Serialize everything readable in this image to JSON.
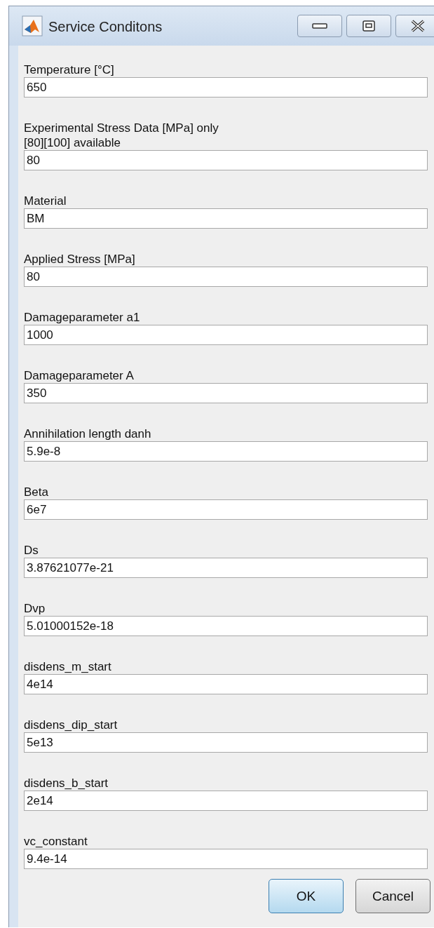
{
  "window": {
    "title": "Service Conditons"
  },
  "fields": [
    {
      "label": "Temperature [°C]",
      "value": "650"
    },
    {
      "label": "Experimental Stress Data [MPa] only\n[80][100] available",
      "value": "80"
    },
    {
      "label": "Material",
      "value": "BM"
    },
    {
      "label": "Applied Stress [MPa]",
      "value": "80"
    },
    {
      "label": "Damageparameter a1",
      "value": "1000"
    },
    {
      "label": "Damageparameter A",
      "value": "350"
    },
    {
      "label": "Annihilation length danh",
      "value": "5.9e-8"
    },
    {
      "label": "Beta",
      "value": "6e7"
    },
    {
      "label": "Ds",
      "value": "3.87621077e-21"
    },
    {
      "label": "Dvp",
      "value": "5.01000152e-18"
    },
    {
      "label": "disdens_m_start",
      "value": "4e14"
    },
    {
      "label": "disdens_dip_start",
      "value": "5e13"
    },
    {
      "label": "disdens_b_start",
      "value": "2e14"
    },
    {
      "label": "vc_constant",
      "value": "9.4e-14"
    }
  ],
  "buttons": [
    {
      "label": "OK",
      "kind": "default"
    },
    {
      "label": "Cancel",
      "kind": "normal"
    }
  ]
}
